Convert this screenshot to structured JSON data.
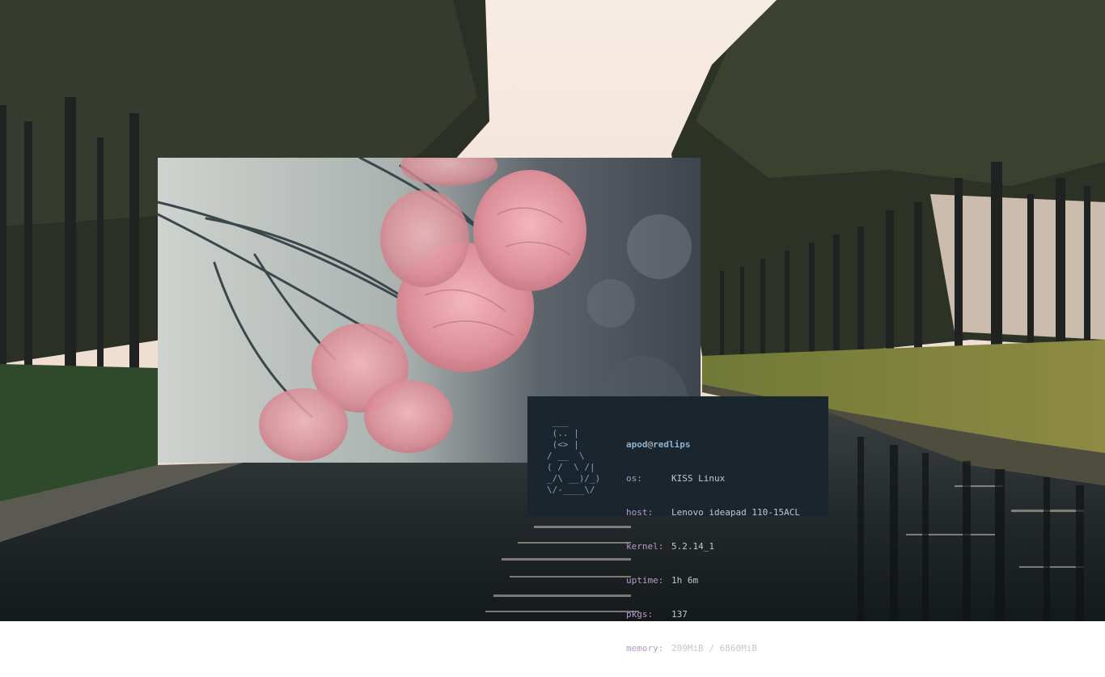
{
  "wallpaper": {
    "description_icon": "tree-lined-canal-landscape",
    "colors": {
      "sky": "#f5e9e0",
      "trees": "#2a2e26",
      "grass": "#7f8b3a",
      "water": "#1a1f22"
    }
  },
  "image_viewer": {
    "subject_icon": "pink-carnation-flowers",
    "colors": {
      "petal": "#e8a6ad",
      "stem": "#3c4a4e",
      "background": "#4a5058",
      "left_bg": "#c6cbc8"
    }
  },
  "terminal": {
    "background": "#1b252d",
    "ascii_logo": " ___\n (.. |\n (<> |\n/ __  \\\n( /  \\ /|\n_/\\ __)/_)\n\\/-____\\/",
    "user": "apod",
    "at": "@",
    "host": "redlips",
    "info": [
      {
        "key": "os:",
        "value": "KISS Linux"
      },
      {
        "key": "host:",
        "value": "Lenovo ideapad 110-15ACL"
      },
      {
        "key": "kernel:",
        "value": "5.2.14_1"
      },
      {
        "key": "uptime:",
        "value": "1h 6m"
      },
      {
        "key": "pkgs:",
        "value": "137"
      },
      {
        "key": "memory:",
        "value": "209MiB / 6860MiB"
      }
    ],
    "colors": {
      "accent": "#8fb3d4",
      "key": "#b69acb",
      "text": "#c3c9cd"
    }
  }
}
